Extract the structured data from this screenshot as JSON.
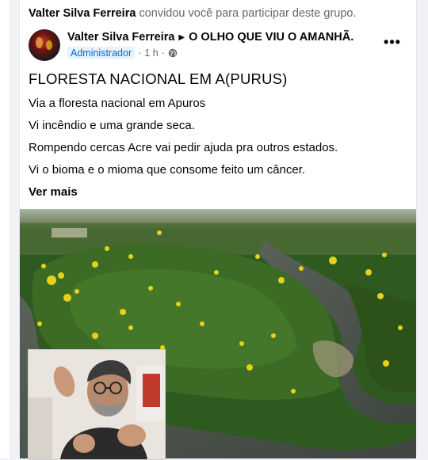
{
  "invite": {
    "inviter": "Valter Silva Ferreira",
    "message": "convidou você para participar deste grupo."
  },
  "post": {
    "author": "Valter Silva Ferreira",
    "group": "O OLHO QUE VIU O AMANHÃ.",
    "role": "Administrador",
    "time": "1 h",
    "separator": "·",
    "more_label": "•••",
    "title": "FLORESTA NACIONAL EM A(PURUS)",
    "lines": [
      "Via a floresta nacional em Apuros",
      "Vi incêndio e uma grande seca.",
      "Rompendo cercas Acre vai pedir ajuda pra outros estados.",
      "Vi o bioma e o mioma que consome feito um câncer."
    ],
    "see_more": "Ver mais"
  },
  "colors": {
    "background": "#f0f2f5",
    "card": "#ffffff",
    "muted_text": "#65676b",
    "badge_bg": "#e7f3ff",
    "badge_text": "#0a66c2",
    "forest": "#2f5a1f",
    "river": "#4a4f4a",
    "flowers": "#e6d21a"
  },
  "icons": {
    "arrow": "triangle-right-icon",
    "privacy": "globe-icon",
    "more": "ellipsis-icon"
  }
}
